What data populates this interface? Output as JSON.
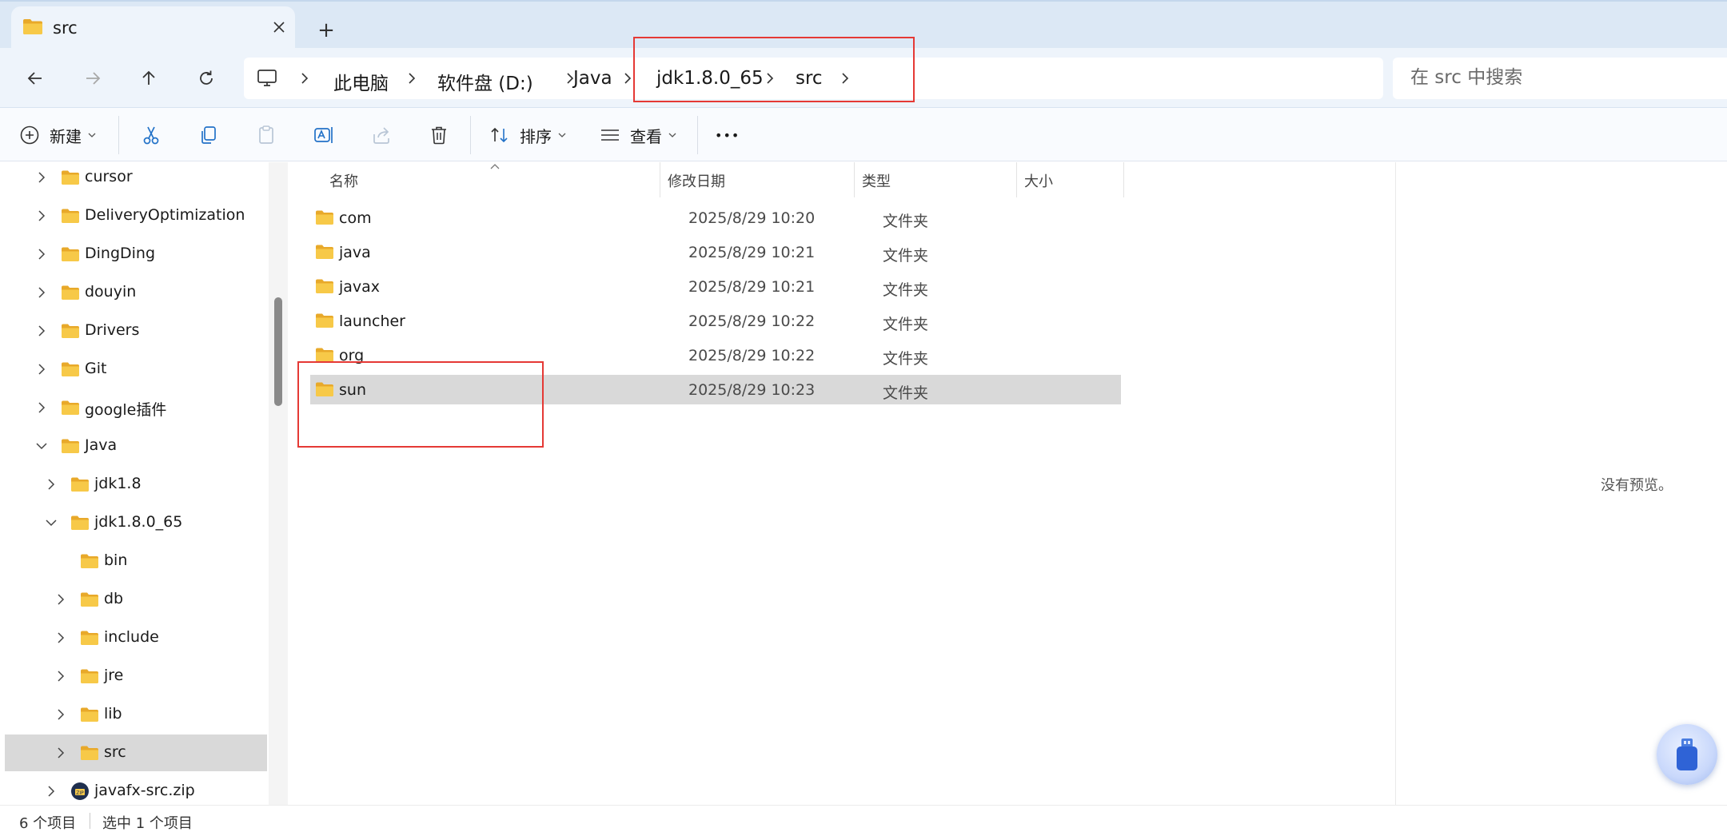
{
  "window": {
    "tab_title": "src",
    "new_tab_symbol": "+"
  },
  "address": {
    "crumbs": [
      "此电脑",
      "软件盘 (D:)",
      "Java",
      "jdk1.8.0_65",
      "src"
    ]
  },
  "search": {
    "placeholder": "在 src 中搜索"
  },
  "toolbar": {
    "new_label": "新建",
    "sort_label": "排序",
    "view_label": "查看",
    "more_label": "•••"
  },
  "nav_tree": [
    {
      "label": "cursor",
      "expanded": false
    },
    {
      "label": "DeliveryOptimization",
      "expanded": false
    },
    {
      "label": "DingDing",
      "expanded": false
    },
    {
      "label": "douyin",
      "expanded": false
    },
    {
      "label": "Drivers",
      "expanded": false
    },
    {
      "label": "Git",
      "expanded": false
    },
    {
      "label": "google插件",
      "expanded": false
    },
    {
      "label": "Java",
      "expanded": true
    },
    {
      "label": "jdk1.8",
      "expanded": false
    },
    {
      "label": "jdk1.8.0_65",
      "expanded": true
    },
    {
      "label": "bin",
      "expanded": null
    },
    {
      "label": "db",
      "expanded": false
    },
    {
      "label": "include",
      "expanded": false
    },
    {
      "label": "jre",
      "expanded": false
    },
    {
      "label": "lib",
      "expanded": false
    },
    {
      "label": "src",
      "expanded": false,
      "selected": true
    },
    {
      "label": "javafx-src.zip",
      "expanded": false,
      "icon": "zip-icon"
    }
  ],
  "columns": {
    "name": "名称",
    "modified": "修改日期",
    "type": "类型",
    "size": "大小"
  },
  "files": [
    {
      "name": "com",
      "modified": "2025/8/29 10:20",
      "type": "文件夹"
    },
    {
      "name": "java",
      "modified": "2025/8/29 10:21",
      "type": "文件夹"
    },
    {
      "name": "javax",
      "modified": "2025/8/29 10:21",
      "type": "文件夹"
    },
    {
      "name": "launcher",
      "modified": "2025/8/29 10:22",
      "type": "文件夹"
    },
    {
      "name": "org",
      "modified": "2025/8/29 10:22",
      "type": "文件夹"
    },
    {
      "name": "sun",
      "modified": "2025/8/29 10:23",
      "type": "文件夹",
      "selected": true
    }
  ],
  "preview": {
    "message": "没有预览。"
  },
  "status": {
    "item_count": "6 个项目",
    "selection": "选中 1 个项目"
  },
  "colors": {
    "accent": "#0067c0",
    "folder": "#f7c948",
    "annotation": "#e53935",
    "selection": "#d9d9d9"
  }
}
